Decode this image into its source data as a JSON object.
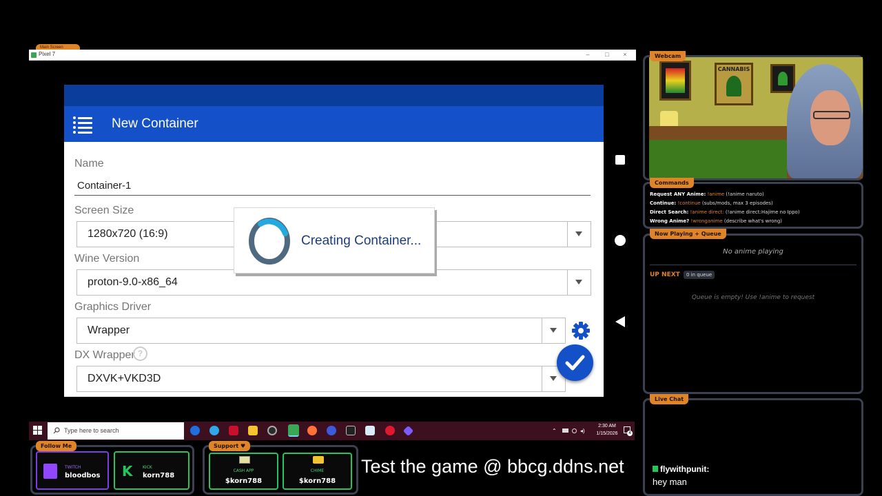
{
  "emulator": {
    "tab_label": "Main Screen",
    "window_title": "Pixel 7",
    "minimize": "–",
    "maximize": "□",
    "close": "×"
  },
  "app": {
    "toolbar_title": "New Container",
    "name_label": "Name",
    "name_value": "Container-1",
    "screen_size_label": "Screen Size",
    "screen_size_value": "1280x720 (16:9)",
    "wine_version_label": "Wine Version",
    "wine_version_value": "proton-9.0-x86_64",
    "graphics_driver_label": "Graphics Driver",
    "graphics_driver_value": "Wrapper",
    "dx_wrapper_label": "DX Wrapper",
    "dx_wrapper_help": "?",
    "dx_wrapper_value": "DXVK+VKD3D",
    "dialog_text": "Creating Container...",
    "accent_color": "#1450c8"
  },
  "taskbar": {
    "search_placeholder": "Type here to search",
    "time": "2:30 AM",
    "date": "1/15/2026",
    "notification_count": "4"
  },
  "webcam": {
    "tab_label": "Webcam",
    "poster_text": "CANNABIS"
  },
  "commands": {
    "tab_label": "Commands",
    "lines": [
      {
        "key": "Request ANY Anime:",
        "cmd": "!anime",
        "desc": "(!anime naruto)"
      },
      {
        "key": "Continue:",
        "cmd": "!continue",
        "desc": "(subs/mods, max 3 episodes)"
      },
      {
        "key": "Direct Search:",
        "cmd": "!anime direct:",
        "desc": "(!anime direct:Hajime no Ippo)"
      },
      {
        "key": "Wrong Anime?",
        "cmd": "!wronganime",
        "desc": "(describe what's wrong)"
      }
    ]
  },
  "now_playing": {
    "tab_label": "Now Playing + Queue",
    "status": "No anime playing",
    "up_next_label": "UP NEXT",
    "queue_count": "0 in queue",
    "queue_empty": "Queue is empty! Use !anime to request"
  },
  "live_chat": {
    "tab_label": "Live Chat",
    "username": "flywithpunit:",
    "message": "hey man"
  },
  "follow": {
    "tab_label": "Follow Me",
    "twitch_label": "TWITCH",
    "twitch_user": "bloodbos",
    "kick_label": "KICK",
    "kick_user": "korn788"
  },
  "support": {
    "tab_label": "Support ♥",
    "cashapp_label": "CASH APP",
    "cashapp_value": "$korn788",
    "chime_label": "CHIME",
    "chime_value": "$korn788"
  },
  "banner": {
    "text": "Test the game @ bbcg.ddns.net"
  }
}
